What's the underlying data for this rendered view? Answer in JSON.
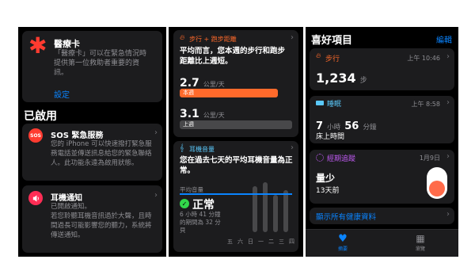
{
  "col1": {
    "medical_id": {
      "title": "醫療卡",
      "desc": "「醫療卡」可以在緊急情況時提供第一位救助者重要的資訊。",
      "setup_link": "設定"
    },
    "enabled_heading": "已啟用",
    "sos": {
      "icon_text": "SOS",
      "title": "SOS 緊急服務",
      "desc": "您的 iPhone 可以快速撥打緊急服務電話並傳送訊息給您的緊急聯絡人。此功能永遠為啟用狀態。"
    },
    "headphone": {
      "title": "耳機通知",
      "desc": "已開啟通知。\n若您聆聽耳機音訊過於大聲，且時間過長可能影響您的聽力，系統將傳送通知。"
    }
  },
  "col2": {
    "walk_card": {
      "category": "步行 + 跑步距離",
      "summary": "平均而言，您本週的步行和跑步距離比上週短。",
      "this_week_value": "2.7",
      "this_week_unit": "公里/天",
      "this_week_label": "本週",
      "last_week_value": "3.1",
      "last_week_unit": "公里/天",
      "last_week_label": "上週",
      "this_week_fraction": 0.87,
      "last_week_fraction": 1.0
    },
    "audio_card": {
      "category": "耳機音量",
      "summary": "您在過去七天的平均耳機音量為正常。",
      "avg_label": "平均音量",
      "status": "正常",
      "detail": "6 小時 41 分鐘的期間為 32 分貝",
      "days": [
        "五",
        "六",
        "日",
        "一",
        "二",
        "三",
        "四"
      ]
    }
  },
  "col3": {
    "title": "喜好項目",
    "edit": "編輯",
    "steps": {
      "label": "步行",
      "time": "上午 10:46",
      "value": "1,234",
      "unit": "步"
    },
    "sleep": {
      "label": "睡眠",
      "time": "上午 8:58",
      "hours": "7",
      "hours_unit": "小時",
      "minutes": "56",
      "minutes_unit": "分鐘",
      "sub": "床上時間"
    },
    "cycle": {
      "label": "經期追蹤",
      "time": "1月9日",
      "value": "量少",
      "sub": "13天前"
    },
    "show_all": "顯示所有健康資料",
    "tabs": [
      {
        "label": "摘要"
      },
      {
        "label": "瀏覽"
      }
    ]
  },
  "colors": {
    "red": "#ff3b30",
    "orange": "#ff6a2b",
    "blue": "#0a84ff",
    "teal": "#5ac8fa",
    "purple": "#bf5af2",
    "green": "#32d74b"
  }
}
